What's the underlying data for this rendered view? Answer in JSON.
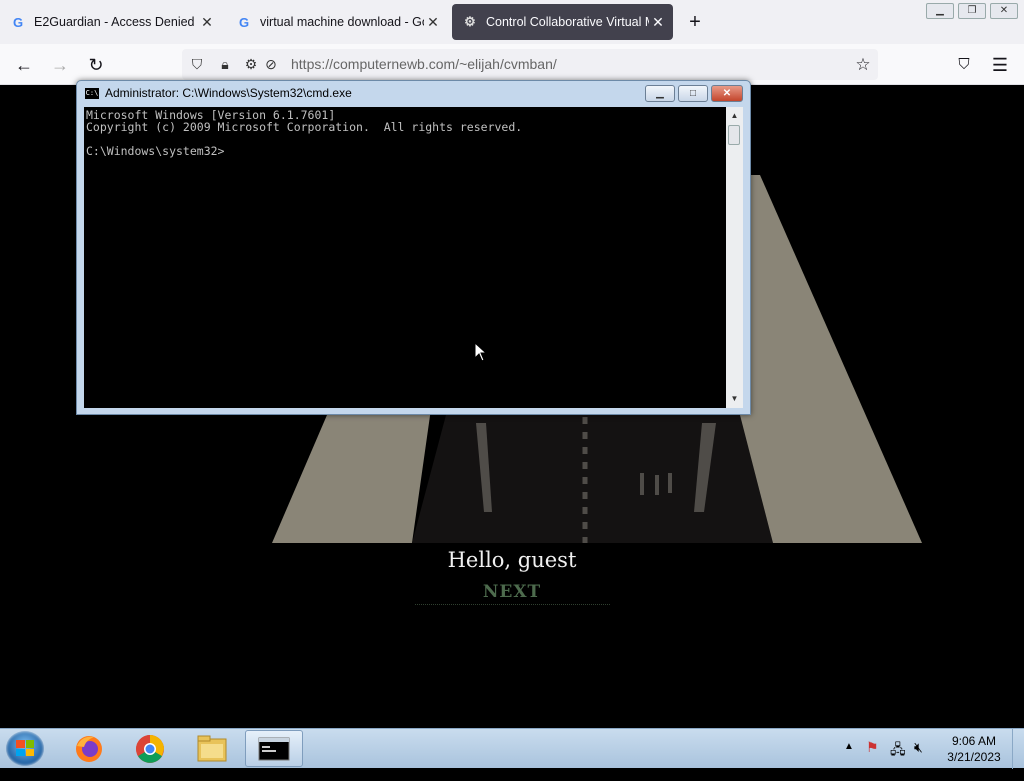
{
  "browser": {
    "tabs": [
      {
        "title": "E2Guardian - Access Denied",
        "icon": "google-icon",
        "active": false
      },
      {
        "title": "virtual machine download - Goo",
        "icon": "google-icon",
        "active": false
      },
      {
        "title": "Control Collaborative Virtual Ma",
        "icon": "cvm-icon",
        "active": true
      }
    ],
    "url_host": "https://computernewb.com",
    "url_path": "/~elijah/cvmban/"
  },
  "cmd": {
    "title": "Administrator: C:\\Windows\\System32\\cmd.exe",
    "lines": [
      "Microsoft Windows [Version 6.1.7601]",
      "Copyright (c) 2009 Microsoft Corporation.  All rights reserved.",
      "",
      "C:\\Windows\\system32>"
    ]
  },
  "page": {
    "greeting": "Hello, guest",
    "next_label": "NEXT"
  },
  "taskbar": {
    "apps": [
      "firefox-icon",
      "chrome-icon",
      "file-explorer-icon",
      "cmd-icon"
    ],
    "time": "9:06 AM",
    "date": "3/21/2023"
  },
  "colors": {
    "road_side": "#8a8577",
    "road_surface": "#141212",
    "road_marking": "#4f4c48",
    "next_text": "#4d6b4d"
  }
}
